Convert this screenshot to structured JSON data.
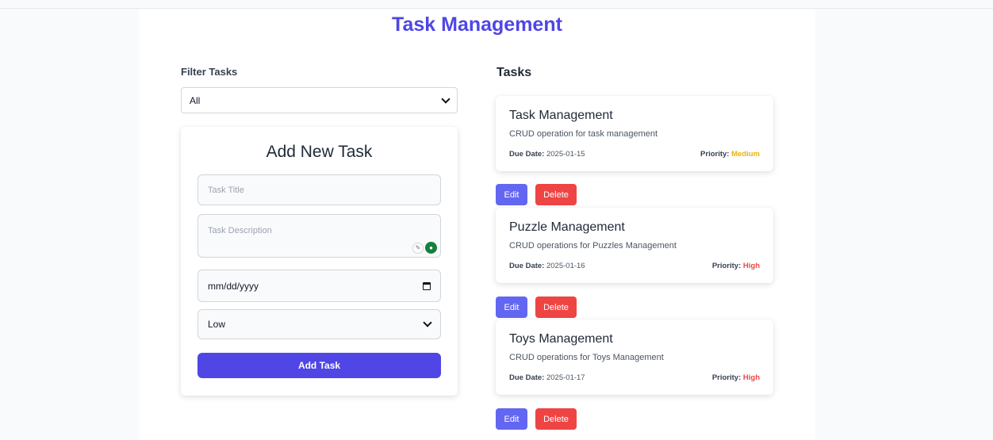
{
  "header": {
    "title": "Task Management"
  },
  "filter": {
    "label": "Filter Tasks",
    "selected": "All"
  },
  "form": {
    "heading": "Add New Task",
    "title_placeholder": "Task Title",
    "description_placeholder": "Task Description",
    "date_value": "mm/dd/yyyy",
    "priority_selected": "Low",
    "submit_label": "Add Task"
  },
  "tasks_section": {
    "heading": "Tasks",
    "due_label": "Due Date:",
    "priority_label": "Priority:",
    "edit_label": "Edit",
    "delete_label": "Delete",
    "items": [
      {
        "title": "Task Management",
        "description": "CRUD operation for task management",
        "due_date": "2025-01-15",
        "priority": "Medium"
      },
      {
        "title": "Puzzle Management",
        "description": "CRUD operations for Puzzles Management",
        "due_date": "2025-01-16",
        "priority": "High"
      },
      {
        "title": "Toys Management",
        "description": "CRUD operations for Toys Management",
        "due_date": "2025-01-17",
        "priority": "High"
      }
    ]
  },
  "colors": {
    "accent": "#4f46e5",
    "edit": "#6366f1",
    "delete": "#ef4444",
    "priority_medium": "#eab308",
    "priority_high": "#ef4444"
  },
  "icons": {
    "select": "chevron-down-icon",
    "date": "calendar-icon",
    "textarea_tools": [
      "paperclip-icon",
      "grammarly-icon"
    ]
  }
}
